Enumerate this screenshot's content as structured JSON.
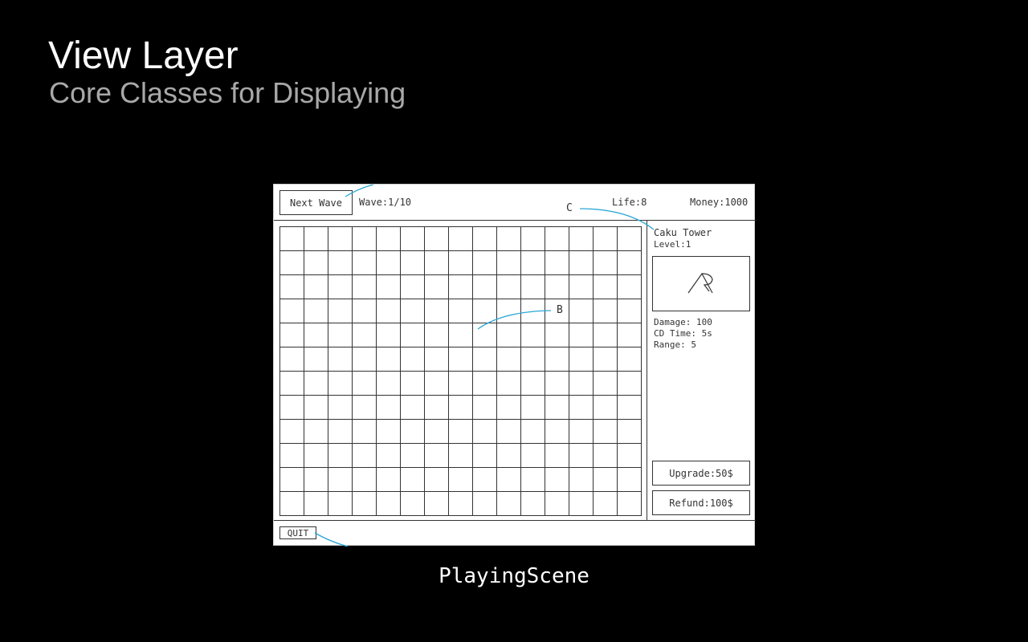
{
  "slide": {
    "title": "View Layer",
    "subtitle": "Core Classes for Displaying",
    "caption": "PlayingScene"
  },
  "topbar": {
    "next_wave_label": "Next Wave",
    "wave": "Wave:1/10",
    "life": "Life:8",
    "money": "Money:1000"
  },
  "grid": {
    "rows": 12,
    "cols": 15
  },
  "tower_panel": {
    "name": "Caku Tower",
    "level": "Level:1",
    "damage": "Damage: 100",
    "cd_time": "CD Time: 5s",
    "range": "Range: 5",
    "upgrade_label": "Upgrade:50$",
    "refund_label": "Refund:100$"
  },
  "bottombar": {
    "quit_label": "QUIT"
  },
  "annotations": {
    "b": "B",
    "c": "C"
  },
  "colors": {
    "annotation_line": "#2aa6d6",
    "background": "#000000",
    "subtitle": "#a8a8a8"
  }
}
